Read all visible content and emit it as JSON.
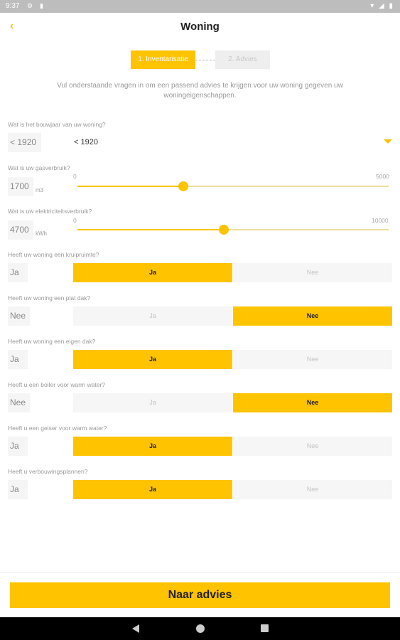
{
  "status_bar": {
    "time": "9:37",
    "settings_icon": "gear-icon",
    "sd_icon": "sd-card-icon",
    "right_icons": "▾ ◢ ▮"
  },
  "header": {
    "back_icon": "‹",
    "title": "Woning"
  },
  "stepper": {
    "step1": "1. Inventarisatie",
    "step2": "2. Advies"
  },
  "intro": "Vul onderstaande vragen in om een passend advies te krijgen voor uw woning gegeven uw woningeigenschappen.",
  "bouwjaar": {
    "label": "Wat is het bouwjaar van uw woning?",
    "value": "< 1920",
    "selected": "< 1920"
  },
  "gas": {
    "label": "Wat is uw gasverbruik?",
    "value": "1700",
    "unit": "m3",
    "min": "0",
    "max": "5000",
    "level_fraction": 0.34
  },
  "elektriciteit": {
    "label": "Wat is uw elektriciteitsverbruik?",
    "value": "4700",
    "unit": "kWh",
    "min": "0",
    "max": "10000",
    "level_fraction": 0.47
  },
  "toggles": [
    {
      "label": "Heeft uw woning een kruipruimte?",
      "value": "Ja",
      "yes": "Ja",
      "no": "Nee",
      "selected": "yes"
    },
    {
      "label": "Heeft uw woning een plat dak?",
      "value": "Nee",
      "yes": "Ja",
      "no": "Nee",
      "selected": "no"
    },
    {
      "label": "Heeft uw woning een eigen dak?",
      "value": "Ja",
      "yes": "Ja",
      "no": "Nee",
      "selected": "yes"
    },
    {
      "label": "Heeft u een boiler voor warm water?",
      "value": "Nee",
      "yes": "Ja",
      "no": "Nee",
      "selected": "no"
    },
    {
      "label": "Heeft u een geiser voor warm water?",
      "value": "Ja",
      "yes": "Ja",
      "no": "Nee",
      "selected": "yes"
    },
    {
      "label": "Heeft u verbouwingsplannen?",
      "value": "Ja",
      "yes": "Ja",
      "no": "Nee",
      "selected": "yes"
    }
  ],
  "cta": "Naar advies",
  "colors": {
    "accent": "#ffc300",
    "inactive": "#f6f6f6"
  }
}
